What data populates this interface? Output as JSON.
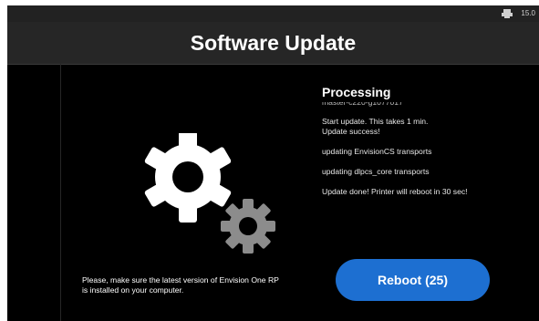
{
  "status_bar": {
    "icon": "printer-icon",
    "version": "15.0"
  },
  "header": {
    "title": "Software Update"
  },
  "log_panel": {
    "title": "Processing",
    "lines": [
      "master-c220-g1077017",
      "Start update. This takes 1 min.",
      "Update success!",
      "updating EnvisionCS transports",
      "updating dlpcs_core transports",
      "Update done! Printer will reboot in 30 sec!"
    ]
  },
  "illustration": {
    "icon": "gears-icon",
    "large_gear_color": "#ffffff",
    "small_gear_color": "#8c8c8c"
  },
  "notice": {
    "text": "Please, make sure the latest version of Envision One RP\nis installed on your computer."
  },
  "reboot_button": {
    "label": "Reboot (25)",
    "color": "#1d6fd1"
  }
}
